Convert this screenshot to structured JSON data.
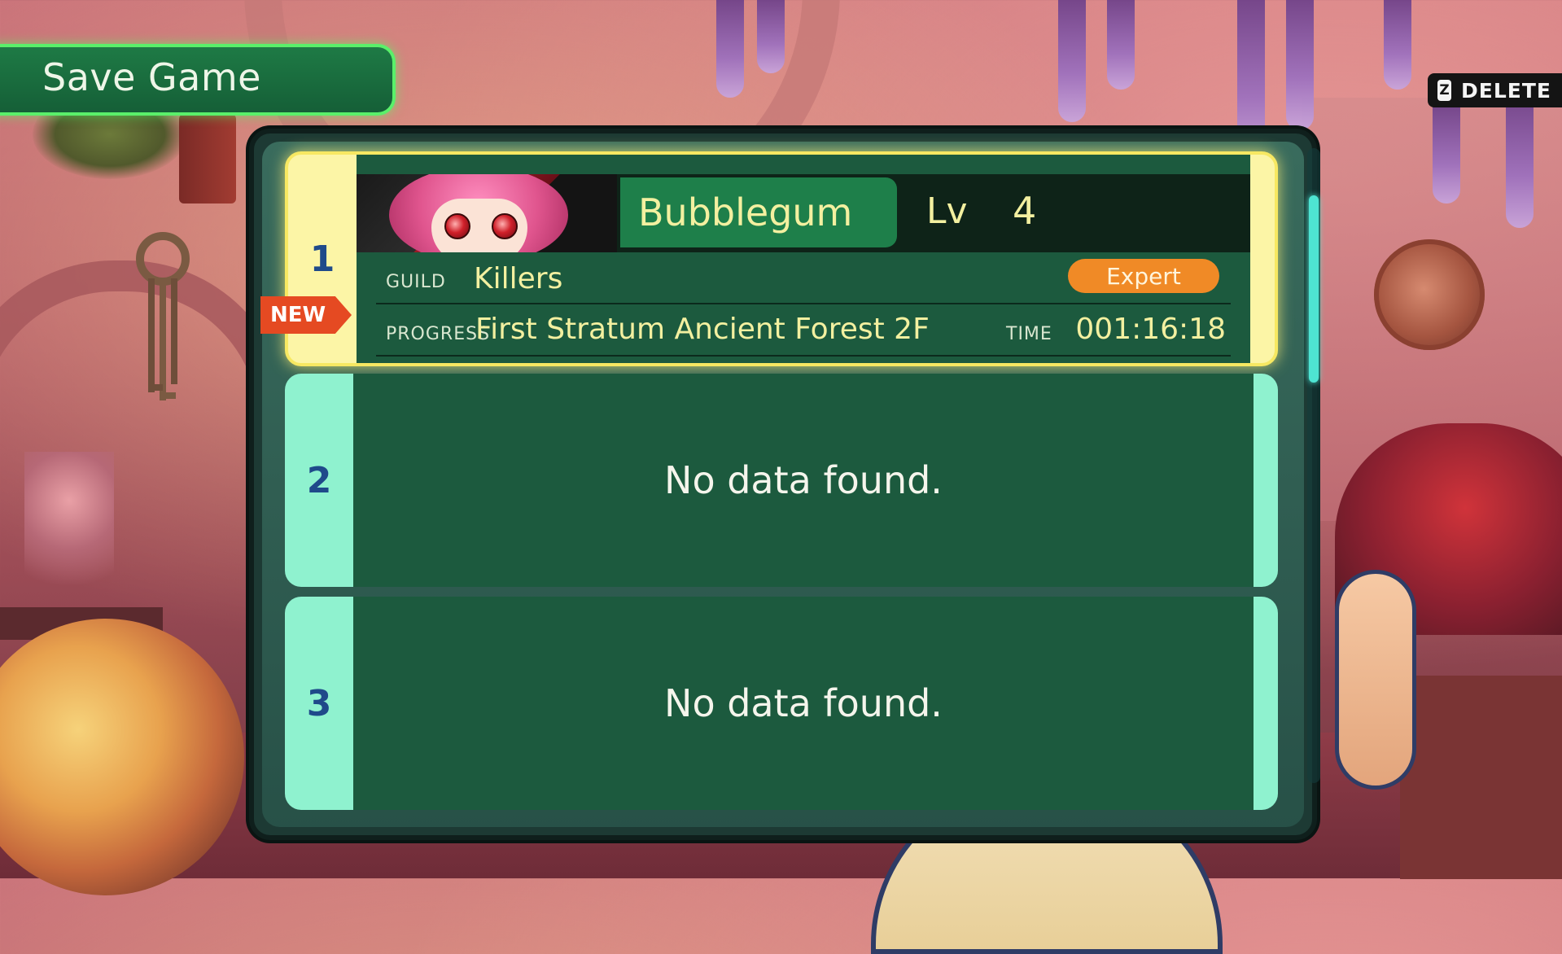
{
  "screen": {
    "title": "Save Game",
    "delete_prompt": {
      "key": "Z",
      "label": "DELETE"
    }
  },
  "slots": [
    {
      "number": "1",
      "new_tag": "NEW",
      "character_name": "Bubblegum",
      "level_label": "Lv",
      "level_value": "4",
      "guild_label": "GUILD",
      "guild_value": "Killers",
      "difficulty": "Expert",
      "progress_label": "PROGRESS",
      "progress_value": "First Stratum Ancient Forest 2F",
      "time_label": "TIME",
      "time_value": "001:16:18"
    },
    {
      "number": "2",
      "empty_text": "No data found."
    },
    {
      "number": "3",
      "empty_text": "No data found."
    }
  ],
  "colors": {
    "slot_selected": "#fcf5a6",
    "slot_default": "#8ff2cf",
    "panel_green": "#1c5a3e",
    "accent_yellow": "#f3f0a0",
    "badge_orange": "#f08a26",
    "new_tag_red": "#e54a22"
  }
}
